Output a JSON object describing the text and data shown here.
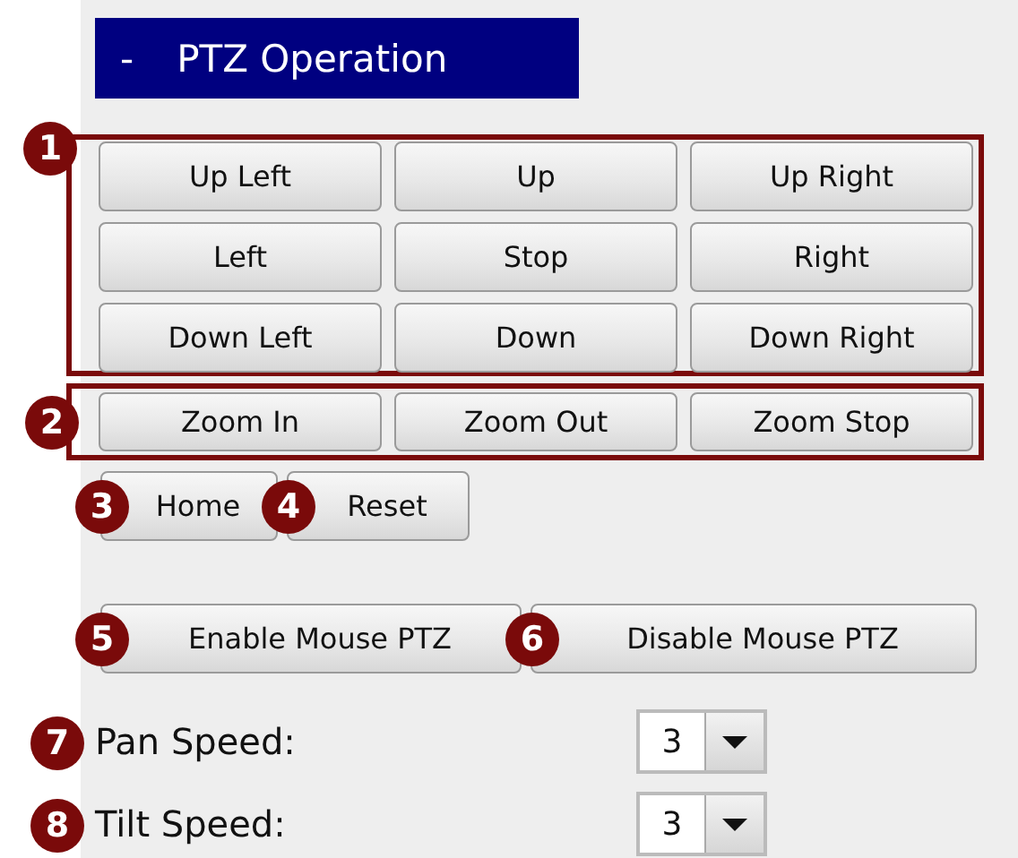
{
  "header": {
    "symbol": "-",
    "title": "PTZ Operation"
  },
  "direction": {
    "marker": "1",
    "buttons": [
      "Up Left",
      "Up",
      "Up Right",
      "Left",
      "Stop",
      "Right",
      "Down Left",
      "Down",
      "Down Right"
    ]
  },
  "zoom": {
    "marker": "2",
    "buttons": [
      "Zoom In",
      "Zoom Out",
      "Zoom Stop"
    ]
  },
  "position_buttons": [
    {
      "marker": "3",
      "label": "Home"
    },
    {
      "marker": "4",
      "label": "Reset"
    }
  ],
  "mouse_buttons": [
    {
      "marker": "5",
      "label": "Enable Mouse PTZ"
    },
    {
      "marker": "6",
      "label": "Disable Mouse PTZ"
    }
  ],
  "speeds": [
    {
      "marker": "7",
      "label": "Pan Speed:",
      "value": "3"
    },
    {
      "marker": "8",
      "label": "Tilt Speed:",
      "value": "3"
    }
  ]
}
